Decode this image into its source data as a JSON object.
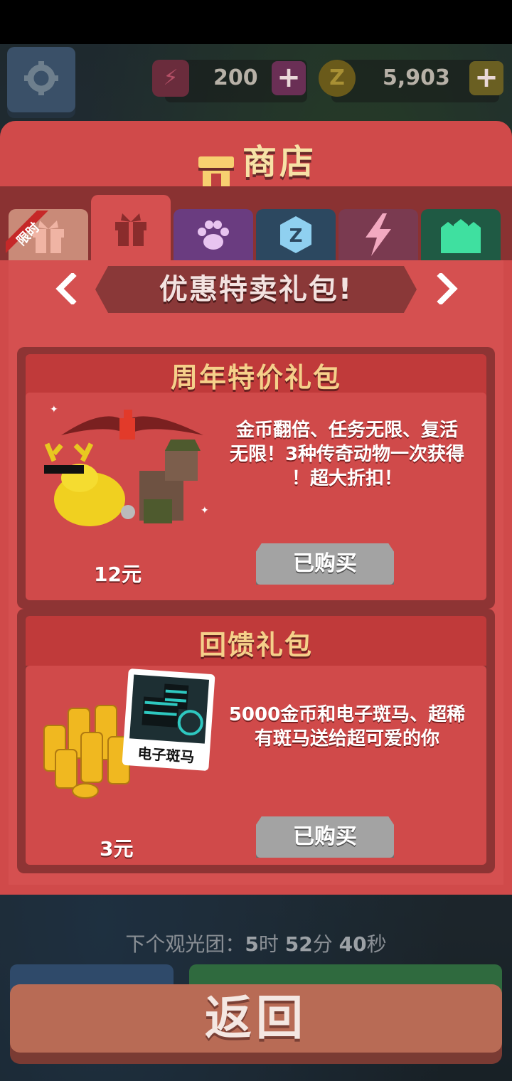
{
  "hud": {
    "energy_value": "200",
    "coin_value": "5,903",
    "plus": "+",
    "coin_glyph": "Z"
  },
  "shop": {
    "title": "商店",
    "limited_badge": "限时",
    "banner": "优惠特卖礼包!",
    "tabs": [
      {
        "name": "limited-gift"
      },
      {
        "name": "gift"
      },
      {
        "name": "animals"
      },
      {
        "name": "coins"
      },
      {
        "name": "energy"
      },
      {
        "name": "buildings"
      }
    ],
    "packages": [
      {
        "title": "周年特价礼包",
        "description_lines": [
          "金币翻倍、任务无限、复活",
          "无限！3种传奇动物一次获得",
          "！超大折扣！"
        ],
        "price": "12元",
        "button": "已购买"
      },
      {
        "title": "回馈礼包",
        "description_lines": [
          "5000金币和电子斑马、超稀",
          "有斑马送给超可爱的你"
        ],
        "card_label": "电子斑马",
        "price": "3元",
        "button": "已购买"
      }
    ]
  },
  "footer": {
    "next_tour_label": "下个观光团：",
    "hours": "5",
    "hours_unit": "时",
    "minutes": "52",
    "minutes_unit": "分",
    "seconds": "40",
    "seconds_unit": "秒",
    "back": "返回"
  },
  "colors": {
    "panel": "#d04a4a",
    "tab_bar": "#8a3232",
    "title_gold": "#f7e2a6",
    "button_gray": "#a3a3a3"
  }
}
